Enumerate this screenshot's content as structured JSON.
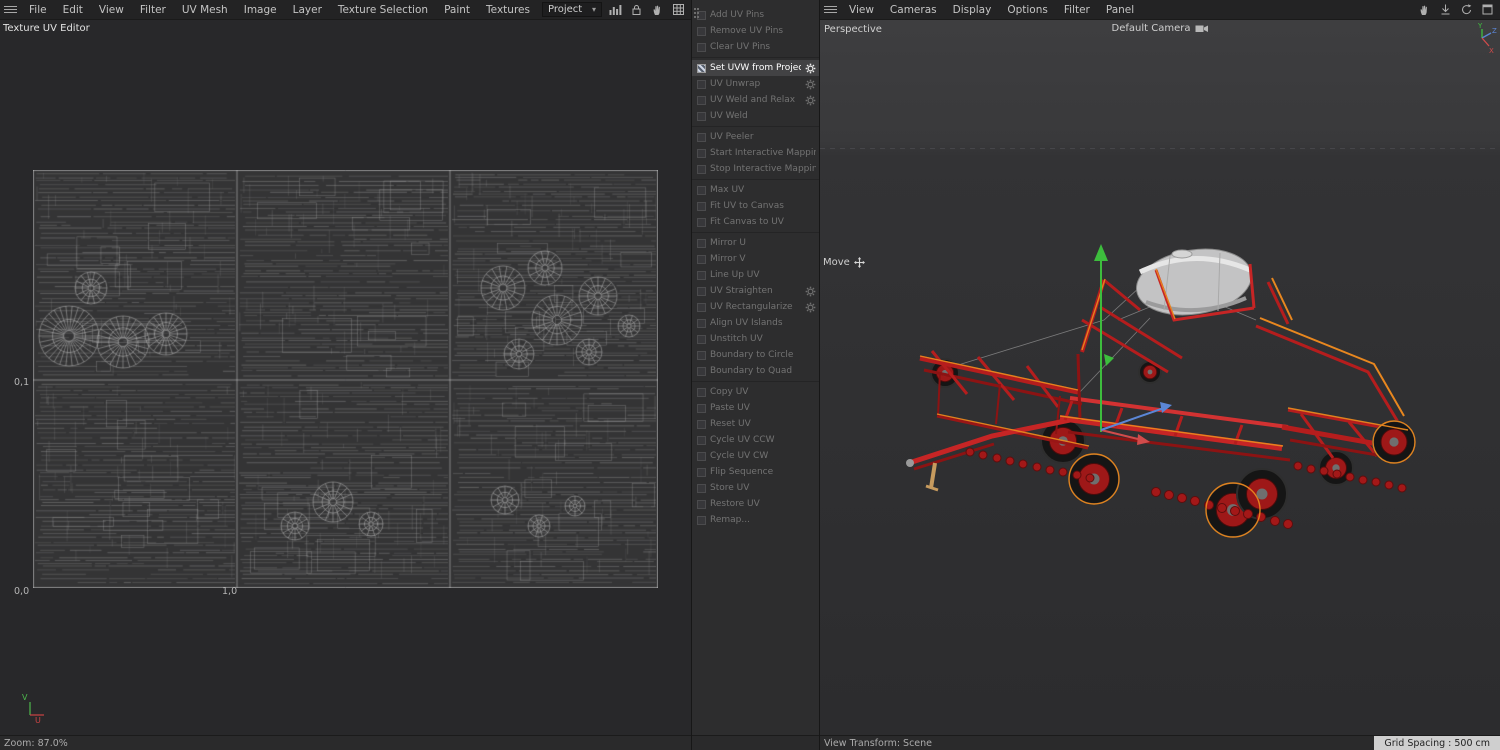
{
  "left_panel": {
    "title": "Texture UV Editor",
    "menu_items": [
      "File",
      "Edit",
      "View",
      "Filter",
      "UV Mesh",
      "Image",
      "Layer",
      "Texture Selection",
      "Paint",
      "Textures"
    ],
    "project_dropdown": {
      "value": "Project"
    },
    "uv_coords": {
      "unit_top": "0,1",
      "origin": "0,0",
      "unit_right": "1,0"
    },
    "axis_labels": {
      "u": "U",
      "v": "V"
    },
    "status": {
      "zoom": "Zoom: 87.0%"
    }
  },
  "command_panel": {
    "groups": [
      [
        {
          "label": "Add UV Pins",
          "enabled": false,
          "gear": false
        },
        {
          "label": "Remove UV Pins",
          "enabled": false,
          "gear": false
        },
        {
          "label": "Clear UV Pins",
          "enabled": false,
          "gear": false
        }
      ],
      [
        {
          "label": "Set UVW from Projection",
          "enabled": true,
          "selected": true,
          "gear": true
        },
        {
          "label": "UV Unwrap",
          "enabled": false,
          "gear": true
        },
        {
          "label": "UV Weld and Relax",
          "enabled": false,
          "gear": true
        },
        {
          "label": "UV Weld",
          "enabled": false,
          "gear": false
        }
      ],
      [
        {
          "label": "UV Peeler",
          "enabled": false,
          "gear": false
        },
        {
          "label": "Start Interactive Mapping",
          "enabled": false,
          "gear": false
        },
        {
          "label": "Stop Interactive Mapping",
          "enabled": false,
          "gear": false
        }
      ],
      [
        {
          "label": "Max UV",
          "enabled": false,
          "gear": false
        },
        {
          "label": "Fit UV to Canvas",
          "enabled": false,
          "gear": false
        },
        {
          "label": "Fit Canvas to UV",
          "enabled": false,
          "gear": false
        }
      ],
      [
        {
          "label": "Mirror U",
          "enabled": false,
          "gear": false
        },
        {
          "label": "Mirror V",
          "enabled": false,
          "gear": false
        },
        {
          "label": "Line Up UV",
          "enabled": false,
          "gear": false
        },
        {
          "label": "UV Straighten",
          "enabled": false,
          "gear": true
        },
        {
          "label": "UV Rectangularize",
          "enabled": false,
          "gear": true
        },
        {
          "label": "Align UV Islands",
          "enabled": false,
          "gear": false
        },
        {
          "label": "Unstitch UV",
          "enabled": false,
          "gear": false
        },
        {
          "label": "Boundary to Circle",
          "enabled": false,
          "gear": false
        },
        {
          "label": "Boundary to Quad",
          "enabled": false,
          "gear": false
        }
      ],
      [
        {
          "label": "Copy UV",
          "enabled": false,
          "gear": false
        },
        {
          "label": "Paste UV",
          "enabled": false,
          "gear": false
        },
        {
          "label": "Reset UV",
          "enabled": false,
          "gear": false
        },
        {
          "label": "Cycle UV CCW",
          "enabled": false,
          "gear": false
        },
        {
          "label": "Cycle UV CW",
          "enabled": false,
          "gear": false
        },
        {
          "label": "Flip Sequence",
          "enabled": false,
          "gear": false
        },
        {
          "label": "Store UV",
          "enabled": false,
          "gear": false
        },
        {
          "label": "Restore UV",
          "enabled": false,
          "gear": false
        },
        {
          "label": "Remap...",
          "enabled": false,
          "gear": false
        }
      ]
    ]
  },
  "viewport": {
    "menu_items": [
      "View",
      "Cameras",
      "Display",
      "Options",
      "Filter",
      "Panel"
    ],
    "view_mode": "Perspective",
    "camera": "Default Camera",
    "active_tool": "Move",
    "axis_gizmo": {
      "x": "X",
      "y": "Y",
      "z": "Z"
    },
    "status": {
      "left": "View Transform: Scene",
      "right": "Grid Spacing : 500 cm"
    }
  },
  "icons": {
    "left_menubar": [
      "hamburger",
      "histogram",
      "lock",
      "hand",
      "grid"
    ],
    "right_menubar": [
      "hamburger",
      "pan-hand",
      "dock-arrow",
      "reset-view",
      "maximize"
    ],
    "camera_label_icon": "camera",
    "move_tool_icon": "move-cross",
    "command_option_icon": "gear"
  },
  "colors": {
    "machine_red": "#c62525",
    "selection_orange": "#e8871f",
    "gizmo_green": "#3dbd3d",
    "gizmo_blue": "#5b86d6",
    "gizmo_red": "#d24b4b",
    "tank_gray": "#c3c3c4"
  }
}
